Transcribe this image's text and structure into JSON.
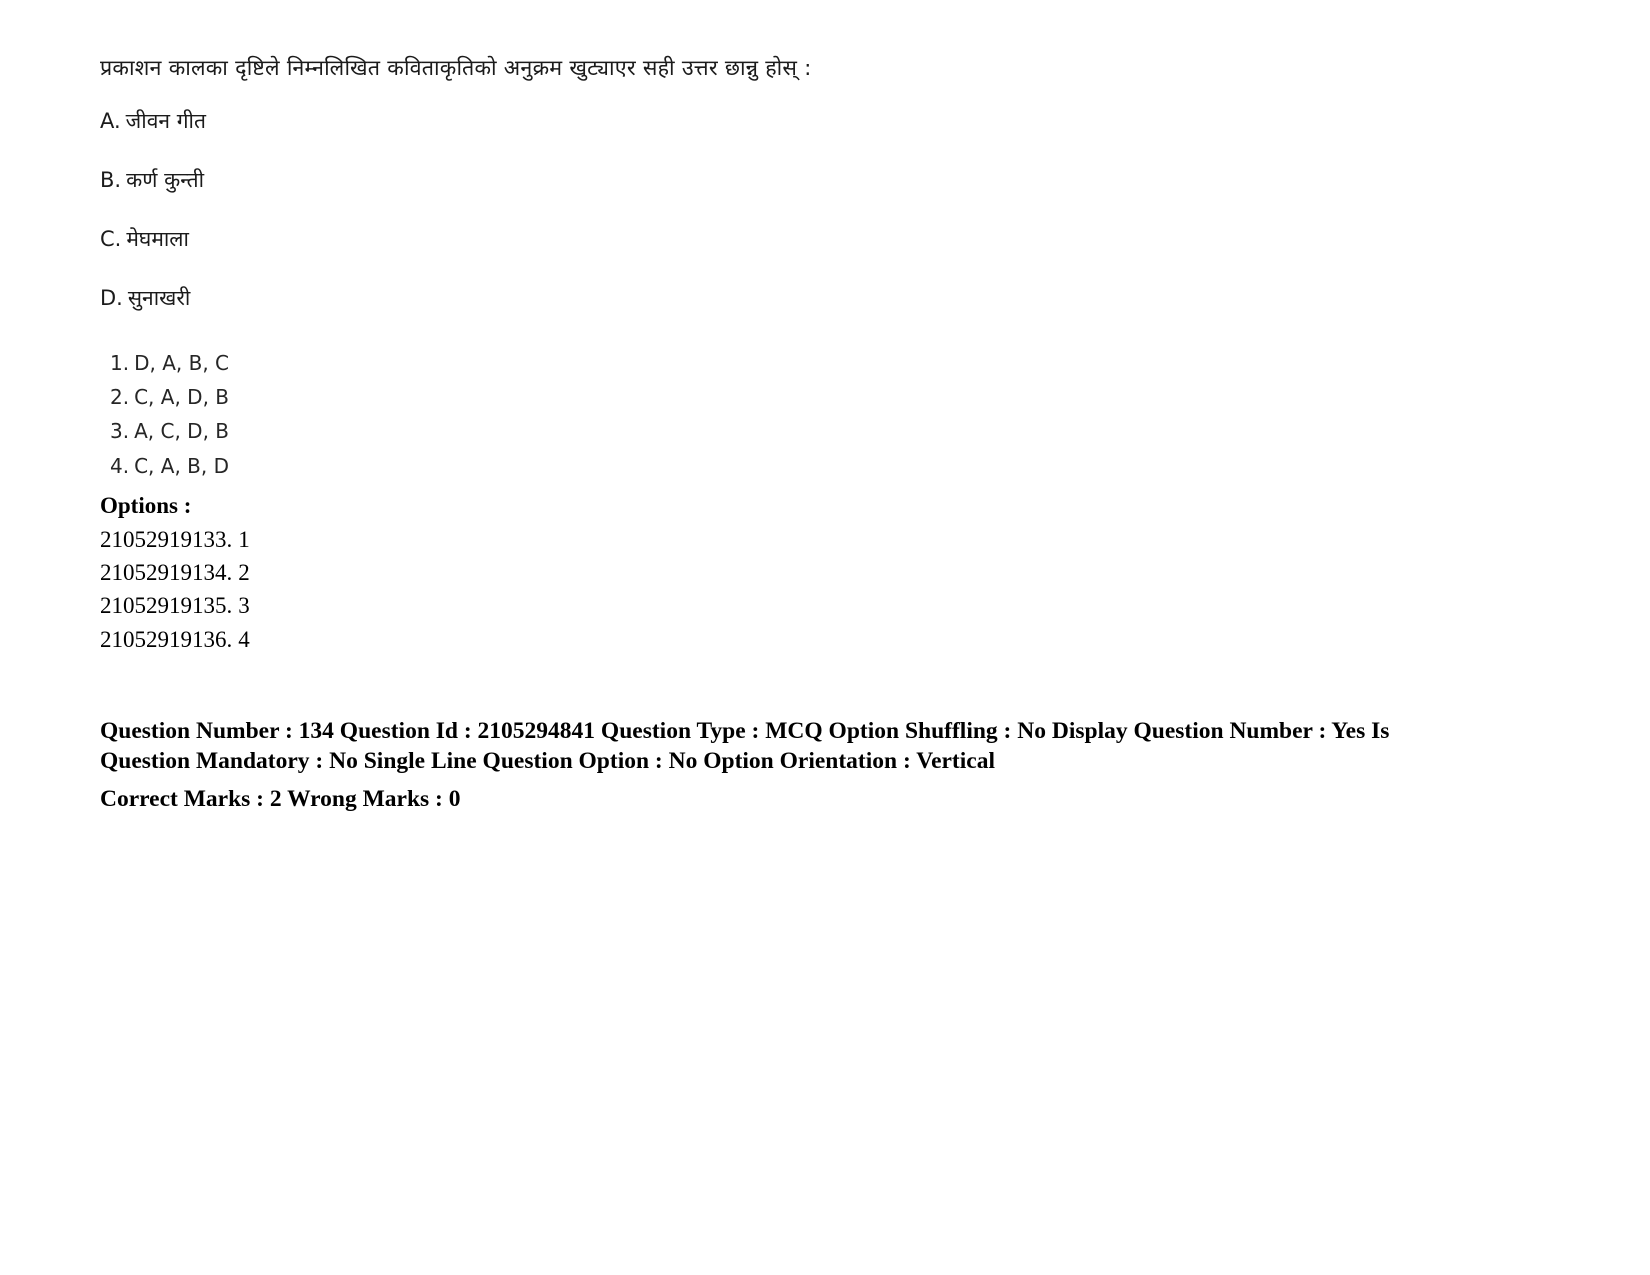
{
  "document": {
    "question_stem": "प्रकाशन कालका दृष्टिले निम्नलिखित कविताकृतिको अनुक्रम खुट्याएर सही उत्तर छान्नु होस् :",
    "statements": [
      {
        "label": "A.",
        "text": "जीवन गीत"
      },
      {
        "label": "B.",
        "text": "कर्ण कुन्ती"
      },
      {
        "label": "C.",
        "text": "मेघमाला"
      },
      {
        "label": "D.",
        "text": "सुनाखरी"
      }
    ],
    "choices": [
      {
        "number": "1.",
        "text": "D, A, B, C"
      },
      {
        "number": "2.",
        "text": "C, A, D, B"
      },
      {
        "number": "3.",
        "text": "A, C, D, B"
      },
      {
        "number": "4.",
        "text": "C, A, B, D"
      }
    ],
    "options_heading": "Options :",
    "option_ids": [
      {
        "id": "21052919133.",
        "value": "1"
      },
      {
        "id": "21052919134.",
        "value": "2"
      },
      {
        "id": "21052919135.",
        "value": "3"
      },
      {
        "id": "21052919136.",
        "value": "4"
      }
    ],
    "metadata": {
      "line1": "Question Number : 134 Question Id : 2105294841 Question Type : MCQ Option Shuffling : No Display Question Number : Yes Is Question Mandatory : No Single Line Question Option : No Option Orientation : Vertical",
      "line2": "Correct Marks : 2 Wrong Marks : 0",
      "question_number": "134",
      "question_id": "2105294841",
      "question_type": "MCQ",
      "option_shuffling": "No",
      "display_question_number": "Yes",
      "is_question_mandatory": "No",
      "single_line_question_option": "No",
      "option_orientation": "Vertical",
      "correct_marks": "2",
      "wrong_marks": "0"
    }
  }
}
